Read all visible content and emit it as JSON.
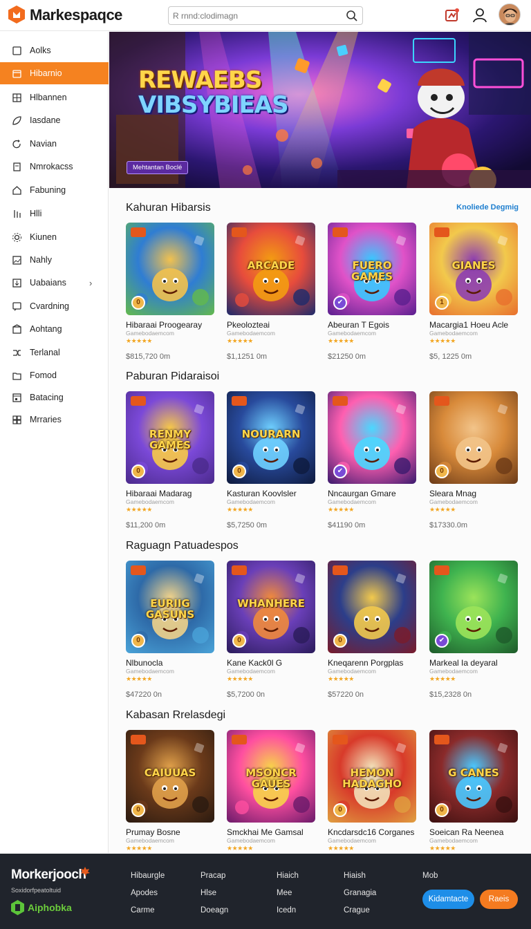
{
  "header": {
    "logo_text": "Markespaqce",
    "search_placeholder": "R rnnd:clodimagn"
  },
  "sidebar": {
    "items": [
      {
        "label": "Aolks",
        "icon": "square-icon"
      },
      {
        "label": "Hibarnio",
        "icon": "calendar-icon",
        "active": true
      },
      {
        "label": "Hlbannen",
        "icon": "grid-icon"
      },
      {
        "label": "Iasdane",
        "icon": "leaf-icon"
      },
      {
        "label": "Navian",
        "icon": "refresh-icon"
      },
      {
        "label": "Nmrokacss",
        "icon": "tag-icon"
      },
      {
        "label": "Fabuning",
        "icon": "home-icon"
      },
      {
        "label": "Hlli",
        "icon": "bars-icon"
      },
      {
        "label": "Kiunen",
        "icon": "gear-icon"
      },
      {
        "label": "Nahly",
        "icon": "image-icon"
      },
      {
        "label": "Uabaians",
        "icon": "download-icon",
        "chevron": "›"
      },
      {
        "label": "Cvardning",
        "icon": "chat-icon"
      },
      {
        "label": "Aohtang",
        "icon": "box-icon"
      },
      {
        "label": "Terlanal",
        "icon": "shuffle-icon"
      },
      {
        "label": "Fomod",
        "icon": "folder-icon"
      },
      {
        "label": "Batacing",
        "icon": "calendar2-icon"
      },
      {
        "label": "Mrraries",
        "icon": "apps-icon"
      }
    ]
  },
  "hero": {
    "title_line1": "REWAEBS",
    "title_line2": "VIBSYBIEAS",
    "badge": "Mehtantan Boclé"
  },
  "sections": [
    {
      "title": "Kahuran Hibarsis",
      "link": "Knoliede Degmig",
      "cards": [
        {
          "name": "Hibaraai Proogearay",
          "sub": "Gamebodaemcom",
          "stars": "★★★★★",
          "price": "$815,720 0m",
          "thumb_text": "",
          "badge": "0"
        },
        {
          "name": "Pkeolozteai",
          "sub": "Gamebodaemcom",
          "stars": "★★★★★",
          "price": "$1,1251 0m",
          "thumb_text": "ARCADE",
          "badge": ""
        },
        {
          "name": "Abeuran T Egois",
          "sub": "Gamebodaemcom",
          "stars": "★★★★★",
          "price": "$21250 0m",
          "thumb_text": "FUERO GAMES",
          "badge": "✔"
        },
        {
          "name": "Macargia1 Hoeu Acle",
          "sub": "Gamebodaemcom",
          "stars": "★★★★★",
          "price": "$5, 1225 0m",
          "thumb_text": "GIANES",
          "badge": "1"
        }
      ]
    },
    {
      "title": "Paburan Pidaraisoi",
      "link": "",
      "cards": [
        {
          "name": "Hibaraai Madarag",
          "sub": "Gamebodaemcom",
          "stars": "★★★★★",
          "price": "$11,200 0m",
          "thumb_text": "RENMY GAMES",
          "badge": "0"
        },
        {
          "name": "Kasturan Koovlsler",
          "sub": "Gamebodaemcom",
          "stars": "★★★★★",
          "price": "$5,7250 0m",
          "thumb_text": "NOURARN",
          "badge": "0"
        },
        {
          "name": "Nncaurgan Gmare",
          "sub": "Gamebodaemcom",
          "stars": "★★★★★",
          "price": "$41190 0m",
          "thumb_text": "",
          "badge": "✔"
        },
        {
          "name": "Sleara Mnag",
          "sub": "Gamebodaemcom",
          "stars": "★★★★★",
          "price": "$17330.0m",
          "thumb_text": "",
          "badge": "0"
        }
      ]
    },
    {
      "title": "Raguagn Patuadespos",
      "link": "",
      "cards": [
        {
          "name": "Nlbunocla",
          "sub": "Gamebodaemcom",
          "stars": "★★★★★",
          "price": "$47220 0n",
          "thumb_text": "EURIIG GASUNS",
          "badge": "0"
        },
        {
          "name": "Kane Kack0l G",
          "sub": "Gamebodaemcom",
          "stars": "★★★★★",
          "price": "$5,7200 0n",
          "thumb_text": "WHANHERE",
          "badge": "0"
        },
        {
          "name": "Kneqarenn Porgplas",
          "sub": "Gamebodaemcom",
          "stars": "★★★★★",
          "price": "$57220 0n",
          "thumb_text": "",
          "badge": "0"
        },
        {
          "name": "Markeal Ia deyaral",
          "sub": "Gamebodaemcom",
          "stars": "★★★★★",
          "price": "$15,2328 0n",
          "thumb_text": "",
          "badge": "✔"
        }
      ]
    },
    {
      "title": "Kabasan Rrelasdegi",
      "link": "",
      "cards": [
        {
          "name": "Prumay Bosne",
          "sub": "Gamebodaemcom",
          "stars": "★★★★★",
          "price": "",
          "thumb_text": "CAIUUAS",
          "badge": "0"
        },
        {
          "name": "Smckhai Me Gamsal",
          "sub": "Gamebodaemcom",
          "stars": "★★★★★",
          "price": "",
          "thumb_text": "MSONCR GAUES",
          "badge": ""
        },
        {
          "name": "Kncdarsdc16 Corganes",
          "sub": "Gamebodaemcom",
          "stars": "★★★★★",
          "price": "",
          "thumb_text": "HEMON HADAGHO",
          "badge": "0"
        },
        {
          "name": "Soeican Ra Neenea",
          "sub": "Gamebodaemcom",
          "stars": "★★★★★",
          "price": "",
          "thumb_text": "G CANES",
          "badge": "0"
        }
      ]
    }
  ],
  "footer": {
    "logo": "Morkerjooch",
    "tagline": "Soxidorfpeatoltuid",
    "app_label": "Aiphobka",
    "columns": [
      [
        "Hibaurgle",
        "Apodes",
        "Carme"
      ],
      [
        "Pracap",
        "Hlse",
        "Doeagn"
      ],
      [
        "Hiaich",
        "Mee",
        "Icedn"
      ],
      [
        "Hiaish",
        "Granagia",
        "Crague"
      ],
      [
        "Mob"
      ]
    ],
    "btn_primary": "Kidamtacte",
    "btn_secondary": "Raeis"
  },
  "colors": {
    "accent": "#f58220",
    "link": "#1f7fcf",
    "star": "#f2a623",
    "footer_bg": "#20242c",
    "footer_btn_blue": "#1e8ee8",
    "footer_btn_orange": "#f47b20"
  }
}
